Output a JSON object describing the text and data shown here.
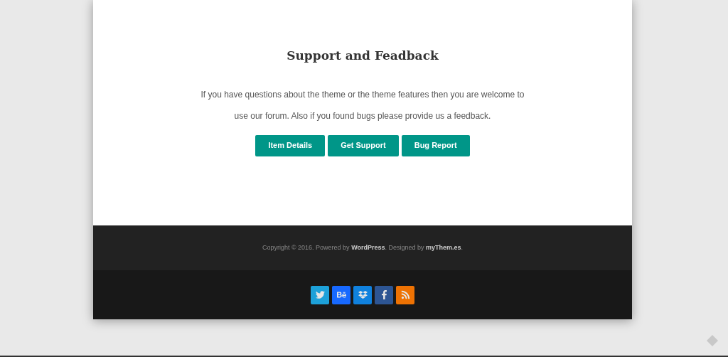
{
  "section": {
    "title": "Support and Feadback",
    "text": "If you have questions about the theme or the theme features then you are welcome to use our forum. Also if you found bugs please provide us a feedback.",
    "buttons": [
      "Item Details",
      "Get Support",
      "Bug Report"
    ]
  },
  "footer": {
    "copyright": [
      {
        "kind": "text",
        "text": "Copyright © 2016. Powered by "
      },
      {
        "kind": "link",
        "text": "WordPress"
      },
      {
        "kind": "text",
        "text": ". Designed by "
      },
      {
        "kind": "link",
        "text": "myThem.es"
      },
      {
        "kind": "text",
        "text": "."
      }
    ]
  },
  "social": [
    {
      "kind": "twitter",
      "color": "#1da1d9"
    },
    {
      "kind": "behance",
      "color": "#1769ff"
    },
    {
      "kind": "dropbox",
      "color": "#1081de"
    },
    {
      "kind": "facebook",
      "color": "#2d5593"
    },
    {
      "kind": "rss",
      "color": "#ee7203"
    }
  ]
}
